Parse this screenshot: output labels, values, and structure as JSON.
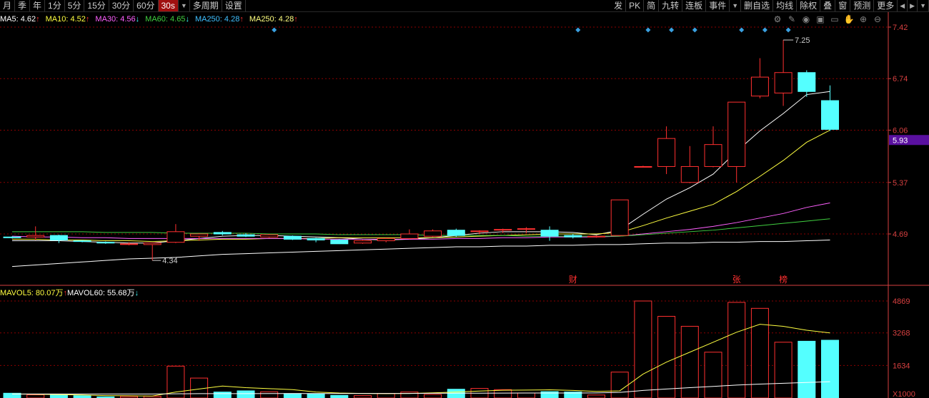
{
  "toolbar": {
    "left": [
      "月",
      "季",
      "年",
      "1分",
      "5分",
      "15分",
      "30分",
      "60分",
      "30s",
      "多周期",
      "设置"
    ],
    "active": "30s",
    "right": [
      "发",
      "PK",
      "简",
      "九转",
      "连板",
      "事件",
      "删自选",
      "均线",
      "除权",
      "叠",
      "窗",
      "预测",
      "更多"
    ]
  },
  "ma": [
    {
      "name": "MA5",
      "value": "4.62",
      "dir": "↑",
      "color": "#ffffff"
    },
    {
      "name": "MA10",
      "value": "4.52",
      "dir": "↑",
      "color": "#ffff40"
    },
    {
      "name": "MA30",
      "value": "4.56",
      "dir": "↓",
      "color": "#ff60ff"
    },
    {
      "name": "MA60",
      "value": "4.65",
      "dir": "↓",
      "color": "#40d040"
    },
    {
      "name": "MA250",
      "value": "4.28",
      "dir": "↑",
      "color": "#40c0ff"
    },
    {
      "name": "MA250",
      "value": "4.28",
      "dir": "↑",
      "color": "#ffff80"
    }
  ],
  "volume_indicator": [
    {
      "name": "MAVOL5",
      "value": "80.07万",
      "dir": "↑",
      "color": "#ffff40"
    },
    {
      "name": "MAVOL60",
      "value": "55.68万",
      "dir": "↓",
      "color": "#ffffff"
    }
  ],
  "colors": {
    "up": "#ff3030",
    "down": "#54ffff",
    "axis": "#d84040",
    "grid": "#8b0000",
    "marker": "#3aa0e0",
    "highlight_bg": "#5a10a0"
  },
  "indicator_icons": [
    "gear-icon",
    "brush-icon",
    "eye-icon",
    "lock-icon",
    "folder-icon",
    "hand-icon",
    "zoom-in-icon",
    "zoom-out-icon"
  ],
  "chart_data": {
    "type": "candlestick",
    "y_ticks": [
      7.42,
      6.74,
      6.06,
      5.37,
      4.69
    ],
    "y_range": [
      4.4,
      7.5
    ],
    "current_price": "5.93",
    "annotations": {
      "max": "7.25",
      "min": "4.34"
    },
    "event_labels": [
      {
        "index": 24,
        "text": "财"
      },
      {
        "index": 31,
        "text": "张"
      },
      {
        "index": 33,
        "text": "榜"
      }
    ],
    "markers": [
      11,
      24,
      27,
      28,
      29,
      31,
      32,
      33
    ],
    "candles": [
      {
        "o": 4.65,
        "h": 4.66,
        "l": 4.63,
        "c": 4.64
      },
      {
        "o": 4.65,
        "h": 4.79,
        "l": 4.61,
        "c": 4.67
      },
      {
        "o": 4.67,
        "h": 4.68,
        "l": 4.57,
        "c": 4.61
      },
      {
        "o": 4.6,
        "h": 4.61,
        "l": 4.58,
        "c": 4.59
      },
      {
        "o": 4.58,
        "h": 4.59,
        "l": 4.56,
        "c": 4.57
      },
      {
        "o": 4.56,
        "h": 4.58,
        "l": 4.54,
        "c": 4.56
      },
      {
        "o": 4.55,
        "h": 4.57,
        "l": 4.34,
        "c": 4.57
      },
      {
        "o": 4.58,
        "h": 4.82,
        "l": 4.57,
        "c": 4.72
      },
      {
        "o": 4.66,
        "h": 4.7,
        "l": 4.6,
        "c": 4.69
      },
      {
        "o": 4.71,
        "h": 4.73,
        "l": 4.67,
        "c": 4.69
      },
      {
        "o": 4.68,
        "h": 4.7,
        "l": 4.65,
        "c": 4.66
      },
      {
        "o": 4.65,
        "h": 4.69,
        "l": 4.64,
        "c": 4.68
      },
      {
        "o": 4.66,
        "h": 4.67,
        "l": 4.61,
        "c": 4.62
      },
      {
        "o": 4.63,
        "h": 4.64,
        "l": 4.58,
        "c": 4.61
      },
      {
        "o": 4.61,
        "h": 4.62,
        "l": 4.57,
        "c": 4.56
      },
      {
        "o": 4.57,
        "h": 4.61,
        "l": 4.56,
        "c": 4.6
      },
      {
        "o": 4.6,
        "h": 4.64,
        "l": 4.58,
        "c": 4.63
      },
      {
        "o": 4.63,
        "h": 4.75,
        "l": 4.62,
        "c": 4.69
      },
      {
        "o": 4.66,
        "h": 4.75,
        "l": 4.65,
        "c": 4.73
      },
      {
        "o": 4.74,
        "h": 4.76,
        "l": 4.65,
        "c": 4.67
      },
      {
        "o": 4.72,
        "h": 4.74,
        "l": 4.69,
        "c": 4.73
      },
      {
        "o": 4.74,
        "h": 4.76,
        "l": 4.7,
        "c": 4.75
      },
      {
        "o": 4.75,
        "h": 4.78,
        "l": 4.7,
        "c": 4.76
      },
      {
        "o": 4.74,
        "h": 4.79,
        "l": 4.6,
        "c": 4.66
      },
      {
        "o": 4.67,
        "h": 4.69,
        "l": 4.63,
        "c": 4.65
      },
      {
        "o": 4.65,
        "h": 4.67,
        "l": 4.64,
        "c": 4.66
      },
      {
        "o": 4.67,
        "h": 5.14,
        "l": 4.66,
        "c": 5.14
      },
      {
        "o": 5.58,
        "h": 5.59,
        "l": 5.57,
        "c": 5.58
      },
      {
        "o": 5.58,
        "h": 6.11,
        "l": 5.48,
        "c": 5.95
      },
      {
        "o": 5.37,
        "h": 5.85,
        "l": 5.36,
        "c": 5.58
      },
      {
        "o": 5.58,
        "h": 6.11,
        "l": 5.57,
        "c": 5.87
      },
      {
        "o": 5.58,
        "h": 6.43,
        "l": 5.37,
        "c": 6.43
      },
      {
        "o": 6.51,
        "h": 7.01,
        "l": 6.48,
        "c": 6.76
      },
      {
        "o": 6.55,
        "h": 7.25,
        "l": 6.38,
        "c": 6.82
      },
      {
        "o": 6.82,
        "h": 6.85,
        "l": 6.5,
        "c": 6.57
      },
      {
        "o": 6.45,
        "h": 6.65,
        "l": 6.05,
        "c": 6.07
      }
    ],
    "volume_ticks": [
      4869,
      3268,
      1634
    ],
    "volume_unit_label": "X1000",
    "volume_max": 4869,
    "volumes": [
      240,
      160,
      150,
      120,
      60,
      80,
      90,
      1600,
      1000,
      300,
      360,
      310,
      220,
      200,
      130,
      120,
      230,
      300,
      180,
      440,
      480,
      420,
      250,
      320,
      300,
      150,
      1300,
      4869,
      4100,
      3600,
      2300,
      4800,
      4500,
      2800,
      2850,
      2900
    ],
    "mavol5": [
      200,
      190,
      170,
      150,
      120,
      110,
      100,
      300,
      450,
      600,
      520,
      470,
      420,
      300,
      250,
      230,
      220,
      230,
      260,
      300,
      350,
      390,
      400,
      410,
      380,
      330,
      360,
      1200,
      1800,
      2300,
      2800,
      3300,
      3700,
      3600,
      3400,
      3268
    ],
    "mavol60": [
      200,
      200,
      200,
      200,
      200,
      200,
      200,
      210,
      220,
      220,
      220,
      225,
      225,
      225,
      225,
      228,
      230,
      230,
      235,
      240,
      240,
      245,
      250,
      250,
      250,
      255,
      280,
      380,
      450,
      520,
      580,
      650,
      700,
      740,
      780,
      820
    ],
    "ma_lines": {
      "ma5": [
        4.6,
        4.6,
        4.6,
        4.59,
        4.58,
        4.57,
        4.57,
        4.6,
        4.63,
        4.66,
        4.67,
        4.67,
        4.66,
        4.65,
        4.64,
        4.62,
        4.61,
        4.62,
        4.64,
        4.67,
        4.7,
        4.72,
        4.72,
        4.72,
        4.71,
        4.68,
        4.74,
        4.95,
        5.15,
        5.3,
        5.48,
        5.78,
        6.05,
        6.28,
        6.53,
        6.57
      ],
      "ma10": [
        4.62,
        4.62,
        4.61,
        4.61,
        4.6,
        4.6,
        4.59,
        4.6,
        4.61,
        4.62,
        4.62,
        4.63,
        4.63,
        4.63,
        4.64,
        4.64,
        4.64,
        4.64,
        4.64,
        4.65,
        4.66,
        4.67,
        4.68,
        4.69,
        4.69,
        4.69,
        4.71,
        4.8,
        4.9,
        4.99,
        5.08,
        5.25,
        5.45,
        5.66,
        5.9,
        6.06
      ],
      "ma30": [
        4.66,
        4.65,
        4.65,
        4.64,
        4.64,
        4.63,
        4.63,
        4.63,
        4.63,
        4.63,
        4.63,
        4.63,
        4.63,
        4.62,
        4.62,
        4.62,
        4.62,
        4.62,
        4.62,
        4.63,
        4.63,
        4.64,
        4.64,
        4.65,
        4.65,
        4.65,
        4.66,
        4.69,
        4.72,
        4.75,
        4.79,
        4.84,
        4.9,
        4.96,
        5.04,
        5.1
      ],
      "ma60": [
        4.72,
        4.72,
        4.72,
        4.72,
        4.71,
        4.71,
        4.71,
        4.7,
        4.7,
        4.7,
        4.7,
        4.69,
        4.69,
        4.69,
        4.68,
        4.68,
        4.68,
        4.68,
        4.67,
        4.67,
        4.67,
        4.67,
        4.66,
        4.66,
        4.66,
        4.66,
        4.66,
        4.68,
        4.7,
        4.72,
        4.74,
        4.77,
        4.8,
        4.83,
        4.86,
        4.89
      ],
      "ma250": [
        4.26,
        4.28,
        4.3,
        4.32,
        4.34,
        4.36,
        4.37,
        4.38,
        4.4,
        4.42,
        4.43,
        4.44,
        4.45,
        4.46,
        4.47,
        4.48,
        4.49,
        4.5,
        4.51,
        4.52,
        4.52,
        4.53,
        4.53,
        4.54,
        4.54,
        4.55,
        4.55,
        4.56,
        4.57,
        4.57,
        4.58,
        4.58,
        4.59,
        4.59,
        4.6,
        4.61
      ]
    }
  }
}
